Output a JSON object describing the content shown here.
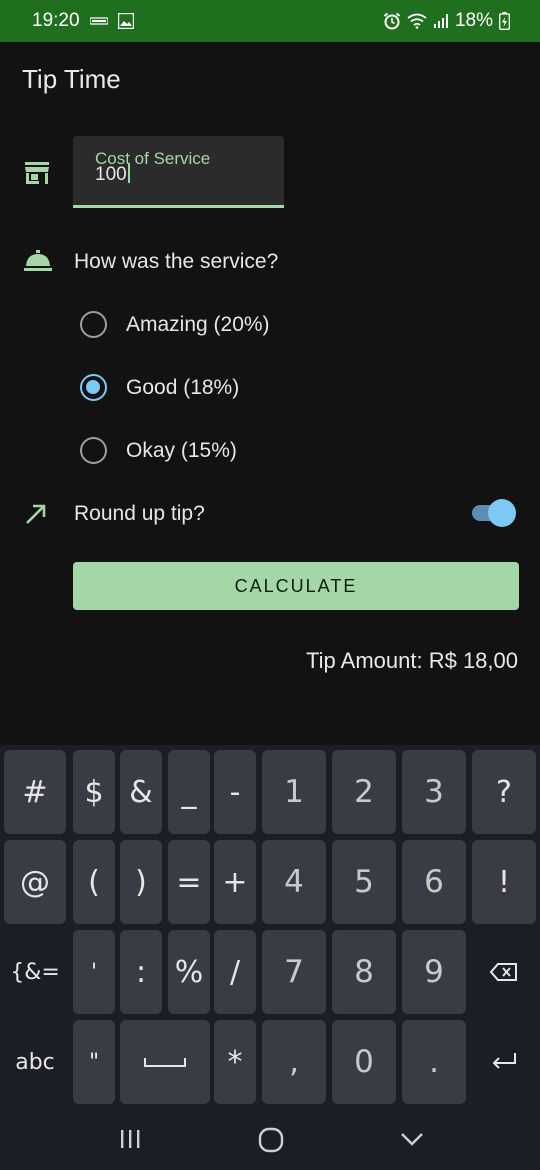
{
  "status_bar": {
    "time": "19:20",
    "battery": "18%"
  },
  "app": {
    "title": "Tip Time"
  },
  "cost_field": {
    "label": "Cost of Service",
    "value": "100"
  },
  "service": {
    "question": "How was the service?",
    "options": [
      {
        "label": "Amazing (20%)",
        "checked": false
      },
      {
        "label": "Good (18%)",
        "checked": true
      },
      {
        "label": "Okay (15%)",
        "checked": false
      }
    ]
  },
  "round_up": {
    "label": "Round up tip?",
    "enabled": true
  },
  "calculate": {
    "label": "CALCULATE"
  },
  "result": {
    "tip_amount": "Tip Amount: R$ 18,00"
  },
  "keyboard": {
    "rows": [
      [
        "#",
        "$",
        "&",
        "_",
        "-",
        "1",
        "2",
        "3",
        "?"
      ],
      [
        "@",
        "(",
        ")",
        "=",
        "+",
        "4",
        "5",
        "6",
        "!"
      ],
      [
        "{&=",
        "'",
        ":",
        "%",
        "/",
        "7",
        "8",
        "9",
        "backspace"
      ],
      [
        "abc",
        "\"",
        "space",
        "*",
        ",",
        "0",
        ".",
        "enter"
      ]
    ],
    "labels": {
      "symbols_toggle": "{&=",
      "abc_toggle": "abc"
    }
  },
  "colors": {
    "status_bar": "#1f6f1f",
    "accent_green": "#a5d6a7",
    "accent_blue": "#7ec8f5",
    "background": "#121212",
    "keyboard": "#1c1e26",
    "key": "#3a3c45"
  },
  "icons": {
    "store": "storefront-icon",
    "bell": "room-service-icon",
    "round": "trending-up-icon",
    "backspace": "backspace-icon",
    "enter": "enter-icon",
    "nav_recent": "recent-apps-icon",
    "nav_home": "home-icon",
    "nav_back": "back-icon"
  }
}
